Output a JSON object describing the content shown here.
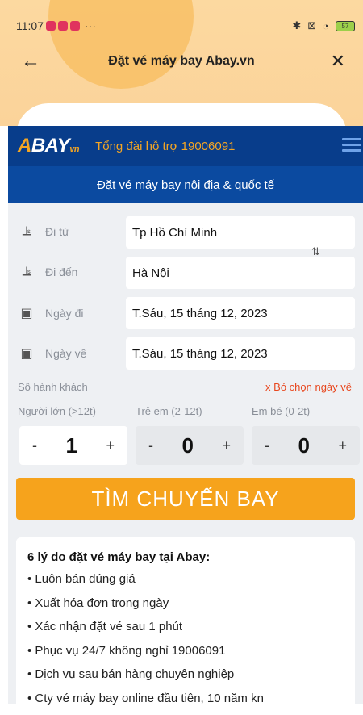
{
  "status": {
    "time": "11:07",
    "dots": "···",
    "icons": [
      "bluetooth-icon",
      "sim-icon",
      "wifi-icon",
      "battery-icon"
    ],
    "battery_level": "57"
  },
  "header": {
    "title": "Đặt vé máy bay Abay.vn",
    "back": "←",
    "close": "✕"
  },
  "brand": {
    "logo_a": "A",
    "logo_bay": "BAY",
    "logo_vn": "vn",
    "hotline": "Tổng đài hỗ trợ 19006091",
    "subtitle": "Đặt vé máy bay nội địa & quốc tế"
  },
  "form": {
    "from": {
      "label": "Đi từ",
      "value": "Tp Hồ Chí Minh"
    },
    "to": {
      "label": "Đi đến",
      "value": "Hà Nội"
    },
    "depart": {
      "label": "Ngày đi",
      "value": "T.Sáu, 15 tháng 12, 2023"
    },
    "return": {
      "label": "Ngày về",
      "value": "T.Sáu, 15 tháng 12, 2023"
    },
    "swap": "⇅",
    "pax_heading": "Số hành khách",
    "remove_return": "x Bỏ chọn ngày về",
    "adult": {
      "label": "Người lớn (>12t)",
      "count": "1"
    },
    "child": {
      "label": "Trẻ em (2-12t)",
      "count": "0"
    },
    "infant": {
      "label": "Em bé (0-2t)",
      "count": "0"
    },
    "minus": "-",
    "plus": "+",
    "search": "TÌM CHUYẾN BAY"
  },
  "reasons": {
    "title": "6 lý do đặt vé máy bay tại Abay:",
    "items": [
      "Luôn bán đúng giá",
      "Xuất hóa đơn trong ngày",
      "Xác nhận đặt vé sau 1 phút",
      "Phục vụ 24/7 không nghỉ 19006091",
      "Dịch vụ sau bán hàng chuyên nghiệp",
      "Cty vé máy bay online đầu tiên, 10 năm kn"
    ]
  },
  "colors": {
    "brand_blue": "#083d8b",
    "accent_orange": "#f6a31c",
    "warning_red": "#e8471e"
  }
}
